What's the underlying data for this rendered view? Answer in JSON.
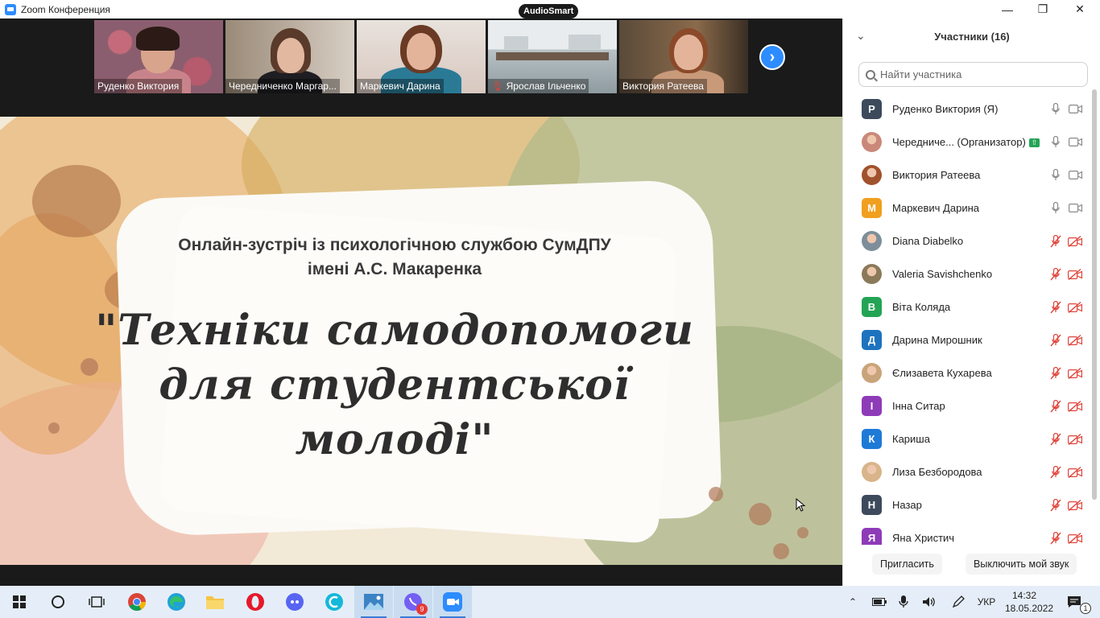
{
  "window": {
    "title": "Zoom Конференция",
    "overlay_badge": "AudioSmart"
  },
  "gallery": {
    "tiles": [
      {
        "name": "Руденко  Виктория",
        "active": false
      },
      {
        "name": "Чередниченко Маргар...",
        "active": false
      },
      {
        "name": "Маркевич Дарина",
        "active": false
      },
      {
        "name": "Ярослав Ільченко",
        "active": false,
        "muted": true
      },
      {
        "name": "Виктория Ратеева",
        "active": true
      }
    ],
    "next_icon": "chevron-right-icon"
  },
  "slide": {
    "subtitle_line1": "Онлайн-зустріч із психологічною службою СумДПУ",
    "subtitle_line2": "імені А.С. Макаренка",
    "title_line1": "\"Техніки самодопомоги",
    "title_line2": "для студентської",
    "title_line3": "молоді\""
  },
  "participants": {
    "header": "Участники (16)",
    "search_placeholder": "Найти участника",
    "list": [
      {
        "initial": "Р",
        "color": "#3d4a5c",
        "photo": false,
        "name": "Руденко  Виктория (Я)",
        "mic_off": false,
        "cam_off": false
      },
      {
        "initial": "",
        "color": "#c9887a",
        "photo": true,
        "name": "Чередниче... (Организатор)",
        "badge": true,
        "mic_off": false,
        "cam_off": false
      },
      {
        "initial": "",
        "color": "#a0522d",
        "photo": true,
        "name": "Виктория Ратеева",
        "mic_off": false,
        "cam_off": false
      },
      {
        "initial": "М",
        "color": "#f0a01e",
        "photo": false,
        "name": "Маркевич Дарина",
        "mic_off": false,
        "cam_off": false
      },
      {
        "initial": "",
        "color": "#7d8e9a",
        "photo": true,
        "name": "Diana Diabelko",
        "mic_off": true,
        "cam_off": true
      },
      {
        "initial": "",
        "color": "#8a7a5a",
        "photo": true,
        "name": "Valeria Savishchenko",
        "mic_off": true,
        "cam_off": true
      },
      {
        "initial": "В",
        "color": "#23a455",
        "photo": false,
        "name": "Віта Коляда",
        "mic_off": true,
        "cam_off": true
      },
      {
        "initial": "Д",
        "color": "#1e73be",
        "photo": false,
        "name": "Дарина Мирошник",
        "mic_off": true,
        "cam_off": true
      },
      {
        "initial": "",
        "color": "#c8a47a",
        "photo": true,
        "name": "Єлизавета Кухарева",
        "mic_off": true,
        "cam_off": true
      },
      {
        "initial": "І",
        "color": "#8e3bb8",
        "photo": false,
        "name": "Інна Ситар",
        "mic_off": true,
        "cam_off": true
      },
      {
        "initial": "К",
        "color": "#1e7ad6",
        "photo": false,
        "name": "Кариша",
        "mic_off": true,
        "cam_off": true
      },
      {
        "initial": "",
        "color": "#d8b48a",
        "photo": true,
        "name": "Лиза Безбородова",
        "mic_off": true,
        "cam_off": true
      },
      {
        "initial": "Н",
        "color": "#3d4a5c",
        "photo": false,
        "name": "Назар",
        "mic_off": true,
        "cam_off": true
      },
      {
        "initial": "Я",
        "color": "#8e3bb8",
        "photo": false,
        "name": "Яна Христич",
        "mic_off": true,
        "cam_off": true
      }
    ],
    "invite_label": "Пригласить",
    "mute_self_label": "Выключить мой звук"
  },
  "taskbar": {
    "apps": [
      "windows-start-icon",
      "search-circle-icon",
      "task-view-icon",
      "chrome-icon",
      "edge-icon",
      "file-explorer-icon",
      "opera-icon",
      "discord-icon",
      "cosmos-icon",
      "photos-icon",
      "viber-icon",
      "zoom-icon"
    ],
    "viber_count": "9",
    "lang": "УКР",
    "time": "14:32",
    "date": "18.05.2022",
    "notification_count": "1"
  }
}
